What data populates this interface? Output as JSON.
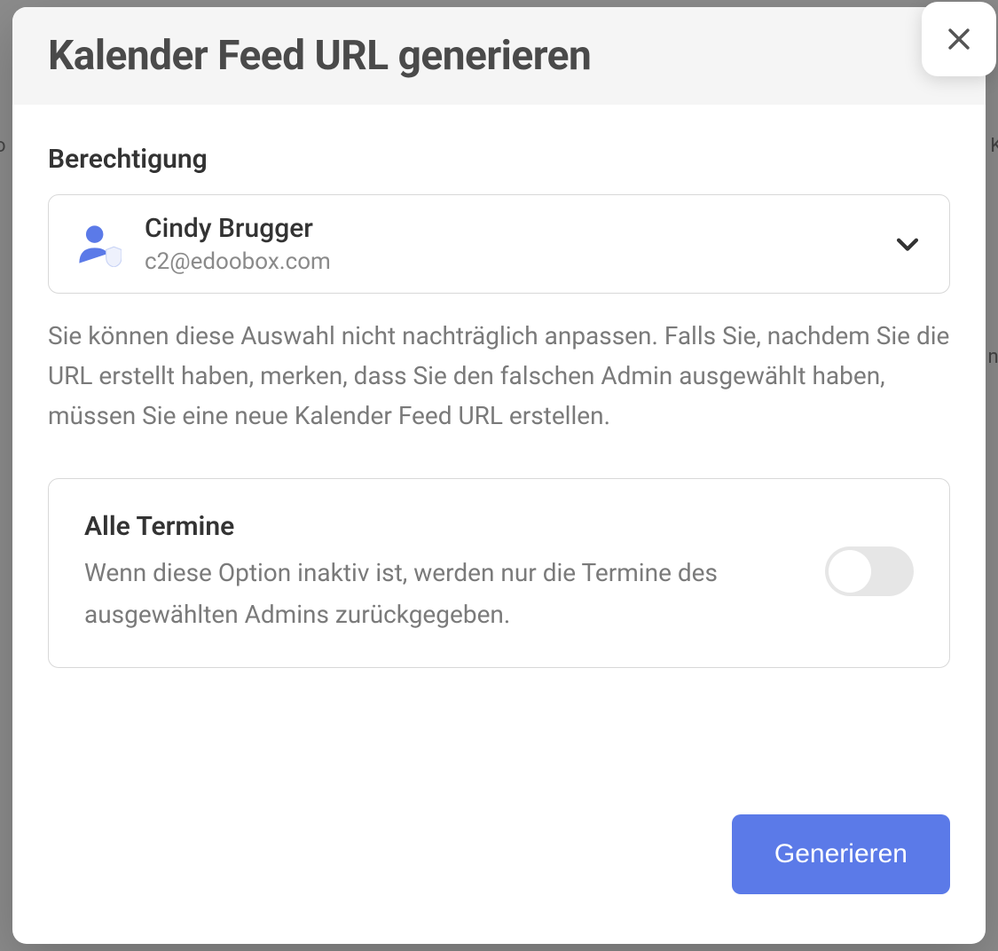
{
  "modal": {
    "title": "Kalender Feed URL generieren",
    "permission_label": "Berechtigung",
    "user": {
      "name": "Cindy Brugger",
      "email": "c2@edoobox.com"
    },
    "permission_help": "Sie können diese Auswahl nicht nachträglich anpassen. Falls Sie, nachdem Sie die URL erstellt haben, merken, dass Sie den falschen Admin ausgewählt haben, müssen Sie eine neue Kalender Feed URL erstellen.",
    "option": {
      "title": "Alle Termine",
      "description": "Wenn diese Option inaktiv ist, werden nur die Termine des ausgewählten Admins zurückgegeben.",
      "active": false
    },
    "generate_label": "Generieren"
  }
}
